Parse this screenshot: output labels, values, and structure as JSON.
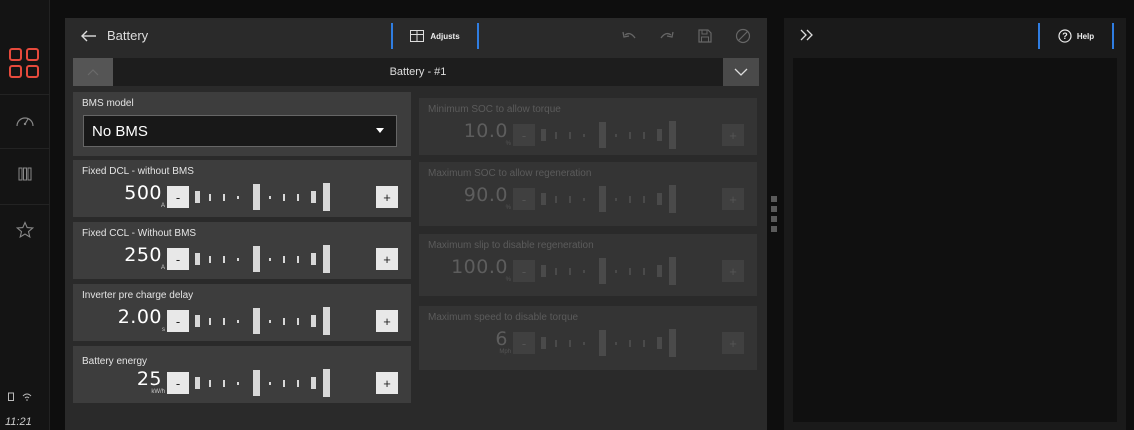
{
  "header": {
    "title": "Battery",
    "adjusts_label": "Adjusts"
  },
  "selector": {
    "value": "Battery - #1"
  },
  "left_params": [
    {
      "label": "BMS model",
      "type": "select",
      "value": "No BMS"
    },
    {
      "label": "Fixed DCL - without BMS",
      "value": "500",
      "unit": "A",
      "minus": "-",
      "plus": "+"
    },
    {
      "label": "Fixed CCL - Without BMS",
      "value": "250",
      "unit": "A",
      "minus": "-",
      "plus": "+"
    },
    {
      "label": "Inverter pre charge delay",
      "value": "2.00",
      "unit": "s",
      "minus": "-",
      "plus": "+"
    },
    {
      "label": "Battery energy",
      "value": "25",
      "unit": "kW/h",
      "minus": "-",
      "plus": "+"
    }
  ],
  "right_params": [
    {
      "label": "Minimum SOC to allow torque",
      "value": "10.0",
      "unit": "%",
      "minus": "-",
      "plus": "+"
    },
    {
      "label": "Maximum SOC to allow regeneration",
      "value": "90.0",
      "unit": "%",
      "minus": "-",
      "plus": "+"
    },
    {
      "label": "Maximum slip to disable regeneration",
      "value": "100.0",
      "unit": "%",
      "minus": "-",
      "plus": "+"
    },
    {
      "label": "Maximum speed to disable torque",
      "value": "6",
      "unit": "Mph",
      "minus": "-",
      "plus": "+"
    }
  ],
  "side": {
    "help_label": "Help"
  },
  "rail": {
    "time": "11:21"
  },
  "colors": {
    "accent": "#2f7de1",
    "brand": "#e64a3c"
  },
  "icons": [
    "logo-icon",
    "gauge-icon",
    "battery-cells-icon",
    "star-icon",
    "back-arrow-icon",
    "table-icon",
    "undo-icon",
    "redo-icon",
    "save-icon",
    "cancel-icon",
    "chevron-up-icon",
    "chevron-down-icon",
    "expand-icon",
    "help-icon",
    "battery-status-icon",
    "wifi-icon"
  ]
}
